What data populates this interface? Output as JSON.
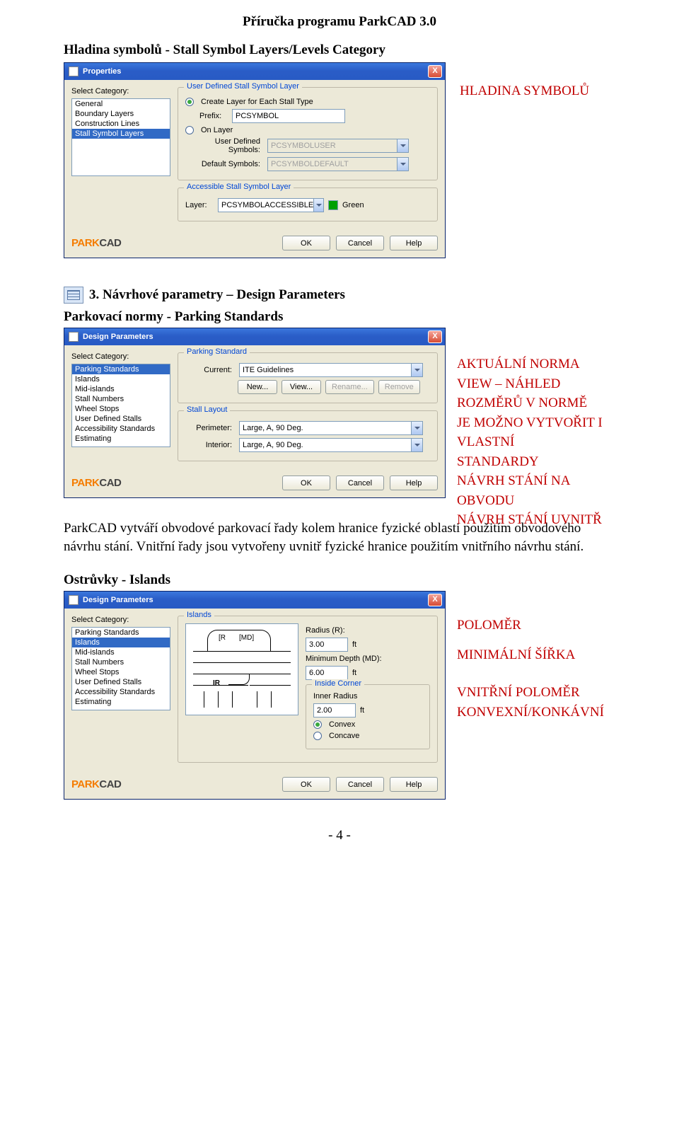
{
  "doc": {
    "header": "Příručka programu ParkCAD 3.0",
    "section1_title": "Hladina symbolů - Stall Symbol Layers/Levels Category",
    "annot_hladina": "HLADINA SYMBOLŮ",
    "section2_prefix": "3.",
    "section2_title": "Návrhové parametry – Design Parameters",
    "sub_parking": "Parkovací normy - Parking Standards",
    "body1": "ParkCAD vytváří obvodové parkovací řady kolem hranice fyzické oblasti použitím obvodového návrhu stání. Vnitřní řady jsou vytvořeny uvnitř fyzické hranice použitím vnitřního návrhu stání.",
    "sub_islands": "Ostrůvky - Islands",
    "page_num": "- 4 -"
  },
  "dlg1": {
    "title": "Properties",
    "select_category": "Select Category:",
    "categories": [
      "General",
      "Boundary Layers",
      "Construction Lines",
      "Stall Symbol Layers"
    ],
    "selected_idx": 3,
    "grp_user": "User Defined Stall Symbol Layer",
    "radio_create": "Create Layer for Each Stall Type",
    "prefix_label": "Prefix:",
    "prefix_value": "PCSYMBOL",
    "radio_on": "On Layer",
    "user_symbols_label": "User Defined Symbols:",
    "user_symbols_value": "PCSYMBOLUSER",
    "default_symbols_label": "Default Symbols:",
    "default_symbols_value": "PCSYMBOLDEFAULT",
    "grp_access": "Accessible Stall Symbol Layer",
    "layer_label": "Layer:",
    "layer_value": "PCSYMBOLACCESSIBLE",
    "color_name": "Green",
    "ok": "OK",
    "cancel": "Cancel",
    "help": "Help"
  },
  "dlg2": {
    "title": "Design Parameters",
    "select_category": "Select Category:",
    "categories": [
      "Parking Standards",
      "Islands",
      "Mid-islands",
      "Stall Numbers",
      "Wheel Stops",
      "User Defined Stalls",
      "Accessibility Standards",
      "Estimating"
    ],
    "selected_idx": 0,
    "grp_std": "Parking Standard",
    "current_label": "Current:",
    "current_value": "ITE Guidelines",
    "btn_new": "New...",
    "btn_view": "View...",
    "btn_rename": "Rename...",
    "btn_remove": "Remove",
    "grp_layout": "Stall Layout",
    "perimeter_label": "Perimeter:",
    "perimeter_value": "Large, A, 90 Deg.",
    "interior_label": "Interior:",
    "interior_value": "Large, A, 90 Deg.",
    "ok": "OK",
    "cancel": "Cancel",
    "help": "Help",
    "annot": {
      "l1": "AKTUÁLNÍ NORMA",
      "l2": "VIEW – NÁHLED ROZMĚRŮ V NORMĚ",
      "l3": "JE MOŽNO VYTVOŘIT I VLASTNÍ",
      "l4": "STANDARDY",
      "l5": "NÁVRH STÁNÍ NA OBVODU",
      "l6": "NÁVRH STÁNÍ UVNITŘ"
    }
  },
  "dlg3": {
    "title": "Design Parameters",
    "select_category": "Select Category:",
    "categories": [
      "Parking Standards",
      "Islands",
      "Mid-islands",
      "Stall Numbers",
      "Wheel Stops",
      "User Defined Stalls",
      "Accessibility Standards",
      "Estimating"
    ],
    "selected_idx": 1,
    "grp_islands": "Islands",
    "radius_label": "Radius (R):",
    "radius_value": "3.00",
    "md_label": "Minimum Depth (MD):",
    "md_value": "6.00",
    "unit": "ft",
    "grp_inside": "Inside Corner",
    "inner_radius_label": "Inner Radius",
    "inner_radius_value": "2.00",
    "radio_convex": "Convex",
    "radio_concave": "Concave",
    "diag": {
      "R": "R",
      "MD": "MD",
      "IR": "IR"
    },
    "ok": "OK",
    "cancel": "Cancel",
    "help": "Help",
    "annot": {
      "l1": "POLOMĚR",
      "l2": "MINIMÁLNÍ ŠÍŘKA",
      "l3": "VNITŘNÍ POLOMĚR",
      "l4": "KONVEXNÍ/KONKÁVNÍ"
    }
  }
}
